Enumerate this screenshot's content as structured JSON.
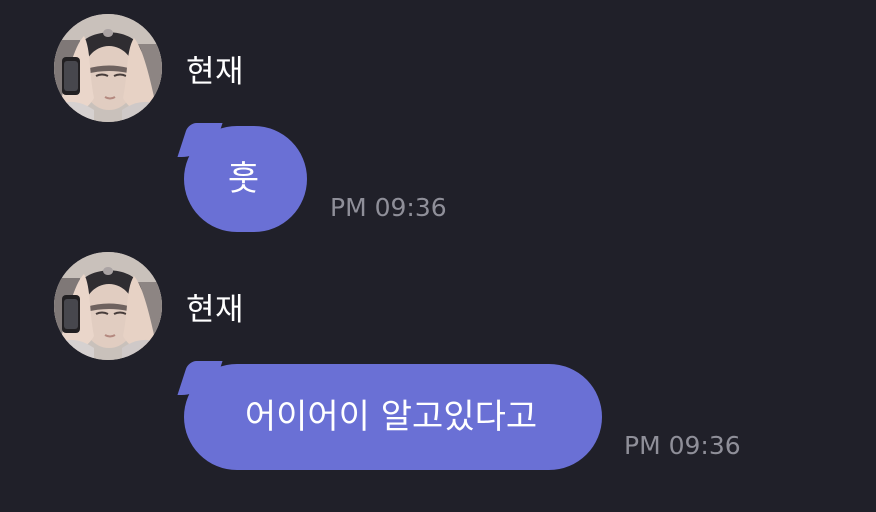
{
  "conversation": {
    "messages": [
      {
        "sender": "현재",
        "text": "훗",
        "time": "PM 09:36",
        "avatar_icon": "profile-photo"
      },
      {
        "sender": "현재",
        "text": "어이어이 알고있다고",
        "time": "PM 09:36",
        "avatar_icon": "profile-photo"
      }
    ],
    "colors": {
      "background": "#202029",
      "bubble": "#6a70d5",
      "timestamp": "#8f8f99",
      "text": "#ffffff"
    }
  }
}
